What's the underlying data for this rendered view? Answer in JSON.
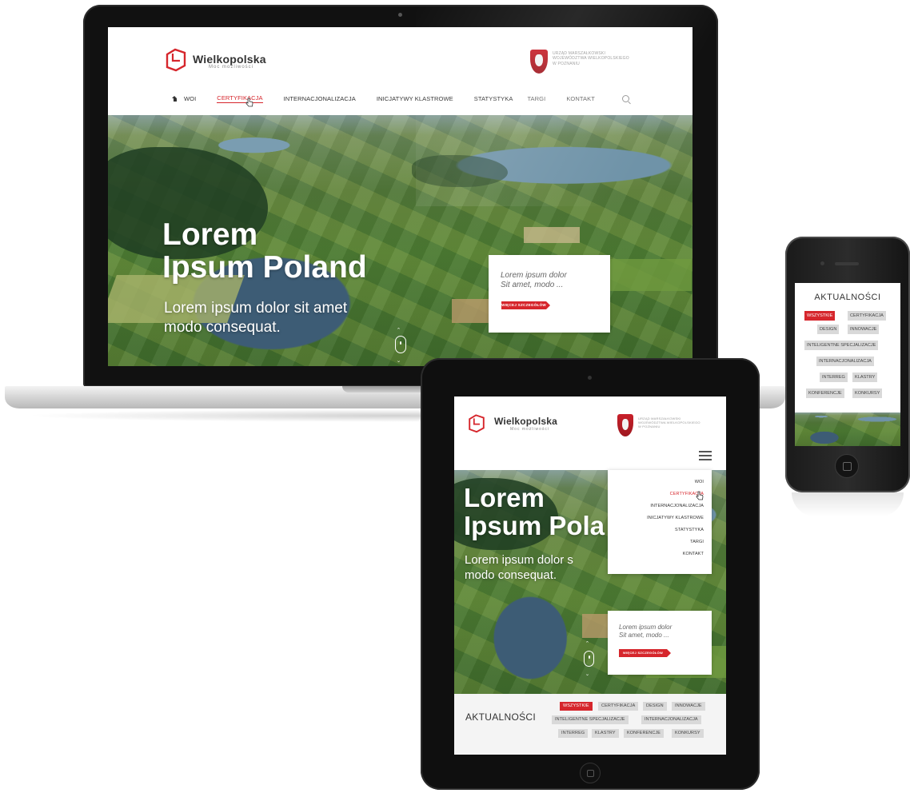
{
  "brand": {
    "name": "Wielkopolska",
    "tagline": "Moc możliwości",
    "office_lines": [
      "URZĄD MARSZAŁKOWSKI",
      "WOJEWÓDZTWA WIELKOPOLSKIEGO",
      "W POZNANIU"
    ],
    "accent_color": "#d6262c"
  },
  "laptop": {
    "nav": [
      {
        "label": "WOI",
        "active": false
      },
      {
        "label": "CERTYFIKACJA",
        "active": true
      },
      {
        "label": "INTERNACJONALIZACJA",
        "active": false
      },
      {
        "label": "INICJATYWY KLASTROWE",
        "active": false
      },
      {
        "label": "STATYSTYKA",
        "active": false
      },
      {
        "label": "TARGI",
        "active": false
      },
      {
        "label": "KONTAKT",
        "active": false
      }
    ],
    "hero": {
      "title_line1": "Lorem",
      "title_line2": "Ipsum Poland",
      "subtitle_line1": "Lorem ipsum dolor sit amet",
      "subtitle_line2": "modo consequat."
    },
    "card": {
      "text_line1": "Lorem ipsum dolor",
      "text_line2": "Sit amet, modo ...",
      "button": "WIĘCEJ SZCZEGÓŁÓW"
    }
  },
  "tablet": {
    "menu": [
      {
        "label": "WOI",
        "active": false
      },
      {
        "label": "CERTYFIKACJA",
        "active": true
      },
      {
        "label": "INTERNACJONALIZACJA",
        "active": false
      },
      {
        "label": "INICJATYWY KLASTROWE",
        "active": false
      },
      {
        "label": "STATYSTYKA",
        "active": false
      },
      {
        "label": "TARGI",
        "active": false
      },
      {
        "label": "KONTAKT",
        "active": false
      }
    ],
    "hero": {
      "title_line1": "Lorem",
      "title_line2": "Ipsum Pola",
      "subtitle_line1": "Lorem ipsum dolor s",
      "subtitle_line2": "modo consequat."
    },
    "card": {
      "text_line1": "Lorem ipsum dolor",
      "text_line2": "Sit amet, modo ...",
      "button": "WIĘCEJ SZCZEGÓŁÓW"
    },
    "news": {
      "title": "AKTUALNOŚCI",
      "chips": [
        "WSZYSTKIE",
        "CERTYFIKACJA",
        "DESIGN",
        "INNOWACJE",
        "INTELIGENTNE SPECJALIZACJE",
        "INTERNACJONALIZACJA",
        "INTERREG",
        "KLASTRY",
        "KONFERENCJE",
        "KONKURSY"
      ]
    }
  },
  "phone": {
    "news": {
      "title": "AKTUALNOŚCI",
      "chips": [
        "WSZYSTKIE",
        "CERTYFIKACJA",
        "DESIGN",
        "INNOWACJE",
        "INTELIGENTNE SPECJALIZACJE",
        "INTERNACJONALIZACJA",
        "INTERREG",
        "KLASTRY",
        "KONFERENCJE",
        "KONKURSY"
      ]
    }
  }
}
